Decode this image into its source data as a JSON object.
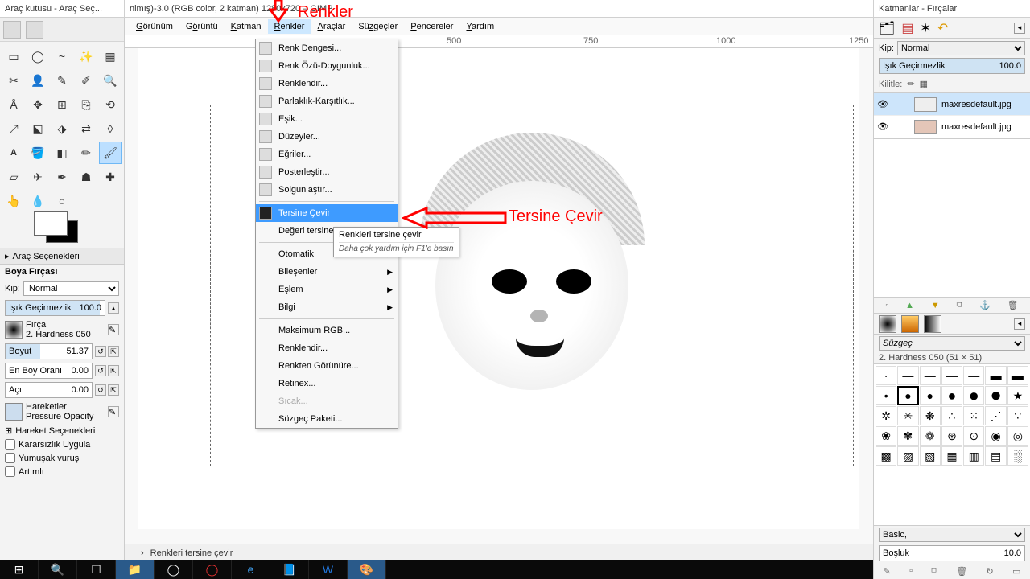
{
  "titles": {
    "toolbox": "Araç kutusu - Araç Seç...",
    "doc": "nlmış)-3.0 (RGB color, 2 katman) 1280x720 – GIMP",
    "right": "Katmanlar - Fırçalar"
  },
  "menu": {
    "items": [
      "Görünüm",
      "Görüntü",
      "Katman",
      "Renkler",
      "Araçlar",
      "Süzgeçler",
      "Pencereler",
      "Yardım"
    ],
    "activeIndex": 3
  },
  "colorsMenu": {
    "top": [
      "Renk Dengesi...",
      "Renk Özü-Doygunluk...",
      "Renklendir...",
      "Parlaklık-Karşıtlık...",
      "Eşik...",
      "Düzeyler...",
      "Eğriler...",
      "Posterleştir...",
      "Solgunlaştır..."
    ],
    "invert": "Tersine Çevir",
    "valueInvert": "Değeri tersine",
    "subs": [
      "Otomatik",
      "Bileşenler",
      "Eşlem",
      "Bilgi"
    ],
    "bottom": [
      "Maksimum RGB...",
      "Renklendir...",
      "Renkten Görünüre...",
      "Retinex..."
    ],
    "hot": "Sıcak...",
    "filterPack": "Süzgeç Paketi..."
  },
  "tooltip": {
    "line1": "Renkleri tersine çevir",
    "line2": "Daha çok yardım için F1'e basın"
  },
  "anno": {
    "t1": "Renkler",
    "t2": "Tersine Çevir"
  },
  "ruler": {
    "m500": "500",
    "m750": "750",
    "m1000": "1000",
    "m1250": "1250"
  },
  "status": "Renkleri tersine çevir",
  "toolOptions": {
    "sectionHead": "Araç Seçenekleri",
    "title": "Boya Fırçası",
    "kipLabel": "Kip:",
    "kipVal": "Normal",
    "opacity": "Işık Geçirmezlik",
    "opacityVal": "100.0",
    "brushLabel": "Fırça",
    "brushName": "2. Hardness 050",
    "sizeLabel": "Boyut",
    "sizeVal": "51.37",
    "ratioLabel": "En Boy Oranı",
    "ratioVal": "0.00",
    "angleLabel": "Açı",
    "angleVal": "0.00",
    "dynHead": "Hareketler",
    "dynVal": "Pressure Opacity",
    "dynOpt": "Hareket Seçenekleri",
    "chk1": "Kararsızlık Uygula",
    "chk2": "Yumuşak vuruş",
    "chk3": "Artımlı"
  },
  "layers": {
    "kipLabel": "Kip:",
    "kipVal": "Normal",
    "opacity": "Işık Geçirmezlik",
    "opacityVal": "100.0",
    "lock": "Kilitle:",
    "l1": "maxresdefault.jpg",
    "l2": "maxresdefault.jpg"
  },
  "brushes": {
    "filter": "Süzgeç",
    "name": "2. Hardness 050 (51 × 51)",
    "basic": "Basic,",
    "spacing": "Boşluk",
    "spacingVal": "10.0"
  }
}
